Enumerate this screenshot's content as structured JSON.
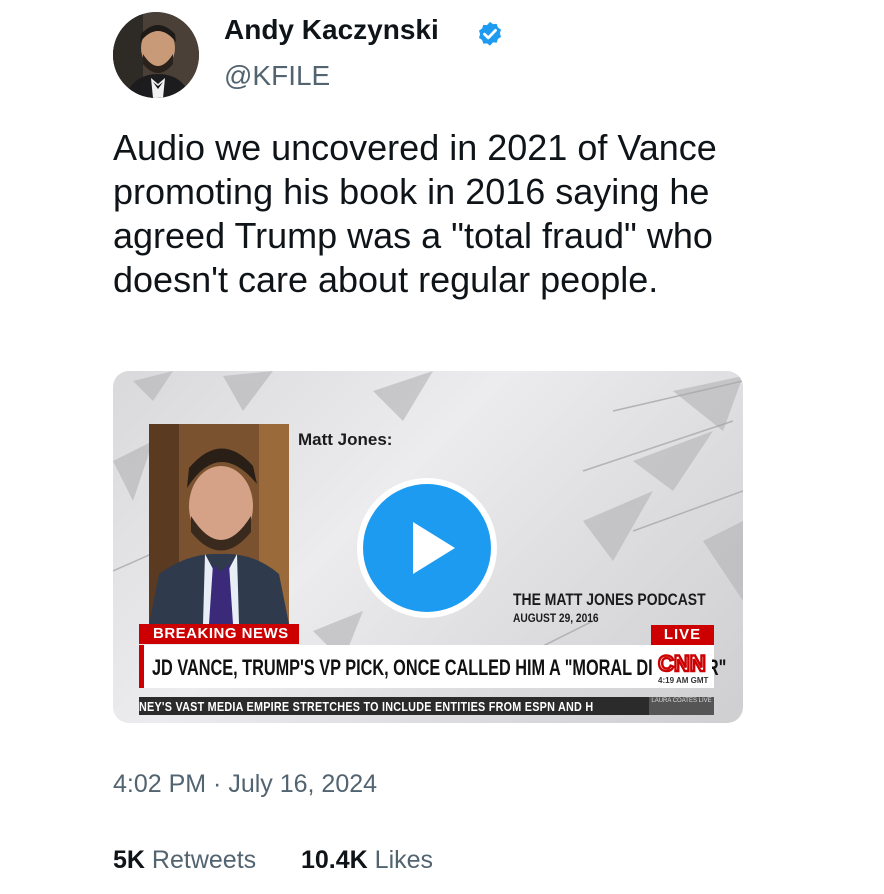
{
  "author": {
    "name": "Andy Kaczynski",
    "handle": "@KFILE",
    "verified": true
  },
  "tweet": {
    "text_lines": [
      "Audio we uncovered in 2021 of Vance",
      "promoting his book in 2016 saying he",
      "agreed Trump was a \"total fraud\" who",
      "doesn't care about regular people."
    ],
    "timestamp": "4:02 PM · July 16, 2024"
  },
  "media": {
    "speaker_label": "Matt Jones:",
    "podcast_title": "THE MATT JONES PODCAST",
    "podcast_date": "AUGUST 29, 2016",
    "breaking_label": "BREAKING NEWS",
    "live_label": "LIVE",
    "headline": "JD VANCE, TRUMP'S VP PICK, ONCE CALLED HIM A \"MORAL DISASTER\"",
    "network_logo": "CNN",
    "network_time": "4:19 AM GMT",
    "ticker": "NEY'S VAST MEDIA EMPIRE STRETCHES TO INCLUDE ENTITIES FROM ESPN AND H",
    "ticker_tag": "LAURA COATES LIVE"
  },
  "stats": {
    "retweets_count": "5K",
    "retweets_label": "Retweets",
    "likes_count": "10.4K",
    "likes_label": "Likes"
  },
  "colors": {
    "accent_blue": "#1d9bf0",
    "cnn_red": "#cc0000",
    "muted_text": "#536471"
  },
  "icons": {
    "verified": "verified-badge-icon",
    "play": "play-icon"
  }
}
